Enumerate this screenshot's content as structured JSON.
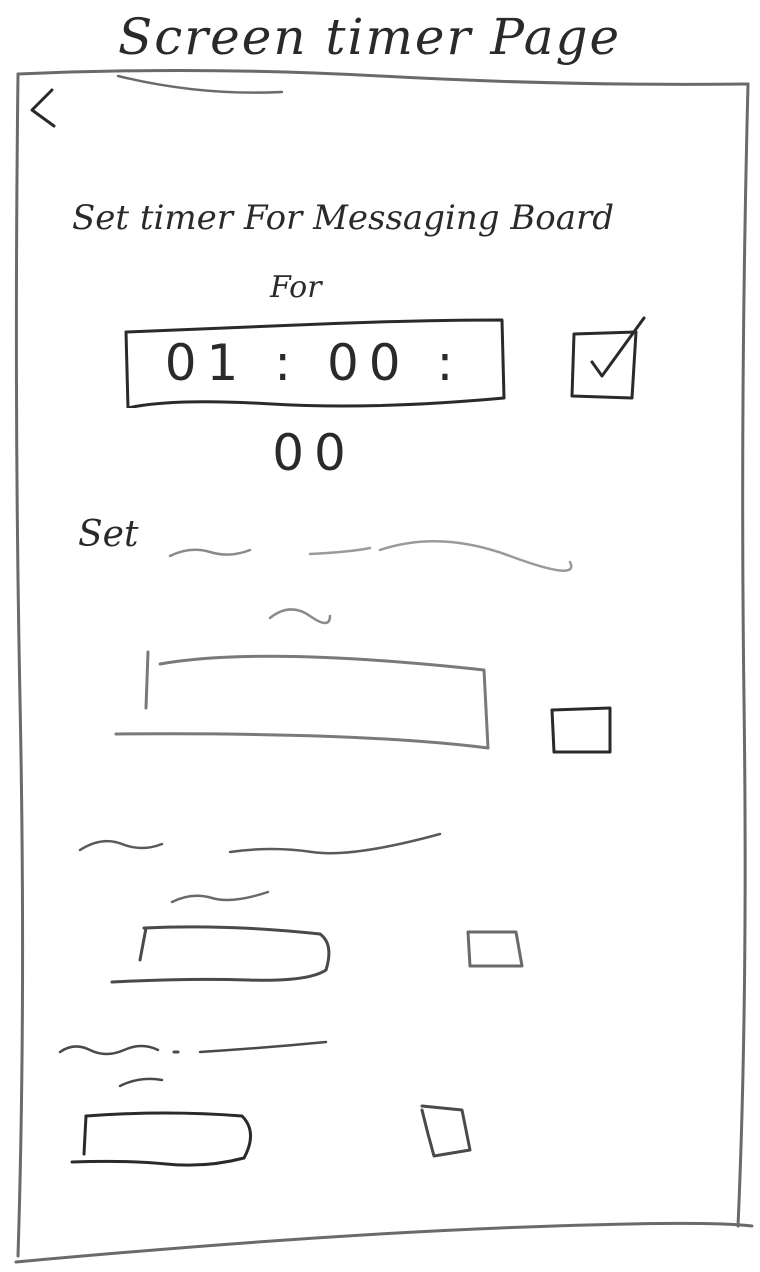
{
  "header": {
    "title": "Screen timer Page"
  },
  "main": {
    "heading": "Set timer For Messaging Board",
    "sub_heading": "For",
    "timer": {
      "value": "01 : 00 : 00",
      "checked": true
    },
    "second_section": {
      "label": "Set",
      "checked": false
    },
    "third_section": {
      "checked": false
    },
    "fourth_section": {
      "checked": false
    }
  },
  "icons": {
    "back": "chevron-left-icon",
    "check": "checkmark-icon"
  },
  "colors": {
    "ink": "#2a2a2a",
    "paper": "#ffffff"
  }
}
